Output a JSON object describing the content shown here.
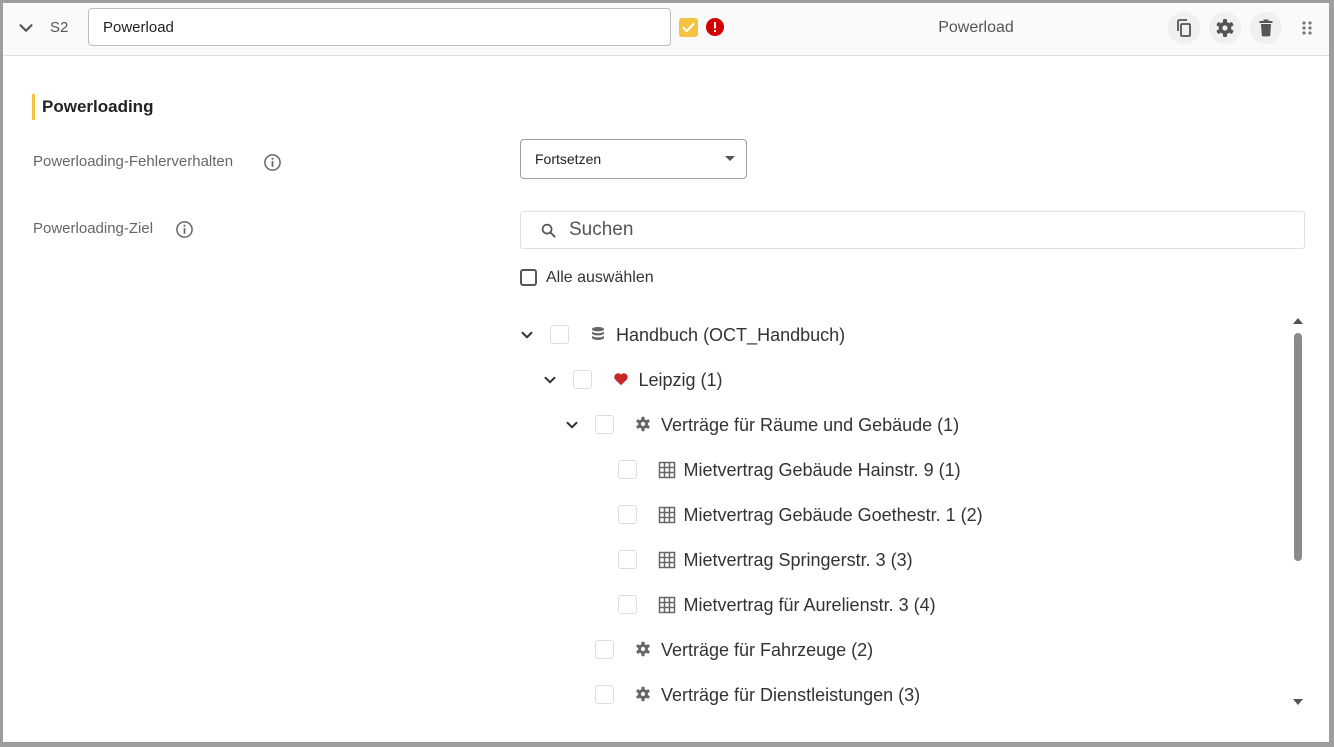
{
  "header": {
    "step_id": "S2",
    "name_value": "Powerload",
    "title": "Powerload"
  },
  "section": {
    "title": "Powerloading"
  },
  "fields": {
    "error_behavior": {
      "label": "Powerloading-Fehlerverhalten",
      "value": "Fortsetzen"
    },
    "target": {
      "label": "Powerloading-Ziel",
      "search_placeholder": "Suchen",
      "select_all_label": "Alle auswählen"
    }
  },
  "tree": [
    {
      "level": 0,
      "expandable": true,
      "icon": "database-icon",
      "label": "Handbuch (OCT_Handbuch)"
    },
    {
      "level": 1,
      "expandable": true,
      "icon": "heart-icon",
      "label": "Leipzig (1)"
    },
    {
      "level": 2,
      "expandable": true,
      "icon": "gear-icon",
      "label": "Verträge für Räume und Gebäude (1)"
    },
    {
      "level": 3,
      "expandable": false,
      "icon": "table-icon",
      "label": "Mietvertrag Gebäude Hainstr. 9 (1)"
    },
    {
      "level": 3,
      "expandable": false,
      "icon": "table-icon",
      "label": "Mietvertrag Gebäude Goethestr. 1 (2)"
    },
    {
      "level": 3,
      "expandable": false,
      "icon": "table-icon",
      "label": "Mietvertrag Springerstr. 3 (3)"
    },
    {
      "level": 3,
      "expandable": false,
      "icon": "table-icon",
      "label": "Mietvertrag für Aurelienstr. 3 (4)"
    },
    {
      "level": 2,
      "expandable": false,
      "icon": "gear-icon",
      "label": "Verträge für Fahrzeuge (2)"
    },
    {
      "level": 2,
      "expandable": false,
      "icon": "gear-icon",
      "label": "Verträge für Dienstleistungen (3)"
    }
  ],
  "colors": {
    "accent": "#f5c242",
    "error": "#d50000",
    "heart": "#c62828"
  }
}
